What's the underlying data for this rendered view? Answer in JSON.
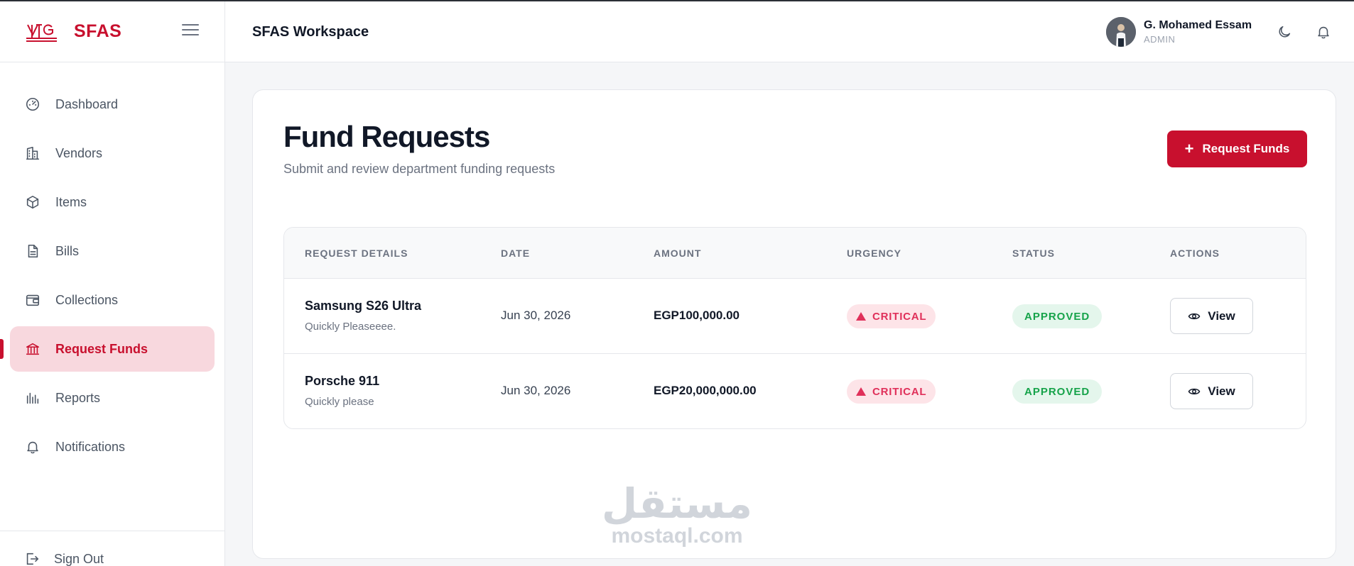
{
  "brand": {
    "name": "SFAS",
    "logo_icon": "ntg-logo"
  },
  "sidebar": {
    "items": [
      {
        "label": "Dashboard",
        "icon": "gauge-icon"
      },
      {
        "label": "Vendors",
        "icon": "building-icon"
      },
      {
        "label": "Items",
        "icon": "cube-icon"
      },
      {
        "label": "Bills",
        "icon": "document-icon"
      },
      {
        "label": "Collections",
        "icon": "wallet-icon"
      },
      {
        "label": "Request Funds",
        "icon": "bank-icon",
        "active": true
      },
      {
        "label": "Reports",
        "icon": "bar-chart-icon"
      },
      {
        "label": "Notifications",
        "icon": "bell-icon"
      }
    ],
    "sign_out": "Sign Out"
  },
  "header": {
    "workspace": "SFAS Workspace",
    "user": {
      "name": "G. Mohamed Essam",
      "role": "ADMIN"
    }
  },
  "page": {
    "title": "Fund Requests",
    "subtitle": "Submit and review department funding requests",
    "primary_button": "Request Funds"
  },
  "table": {
    "columns": [
      "REQUEST DETAILS",
      "DATE",
      "AMOUNT",
      "URGENCY",
      "STATUS",
      "ACTIONS"
    ],
    "rows": [
      {
        "name": "Samsung S26 Ultra",
        "note": "Quickly Pleaseeee.",
        "date": "Jun 30, 2026",
        "amount": "EGP100,000.00",
        "urgency": "CRITICAL",
        "status": "APPROVED",
        "action": "View"
      },
      {
        "name": "Porsche 911",
        "note": "Quickly please",
        "date": "Jun 30, 2026",
        "amount": "EGP20,000,000.00",
        "urgency": "CRITICAL",
        "status": "APPROVED",
        "action": "View"
      }
    ]
  },
  "watermark": {
    "arabic": "مستقل",
    "latin": "mostaql.com"
  },
  "colors": {
    "accent": "#c8102e",
    "active_bg": "#f8d8de",
    "critical": "#e0305a",
    "approved": "#16a34a"
  }
}
